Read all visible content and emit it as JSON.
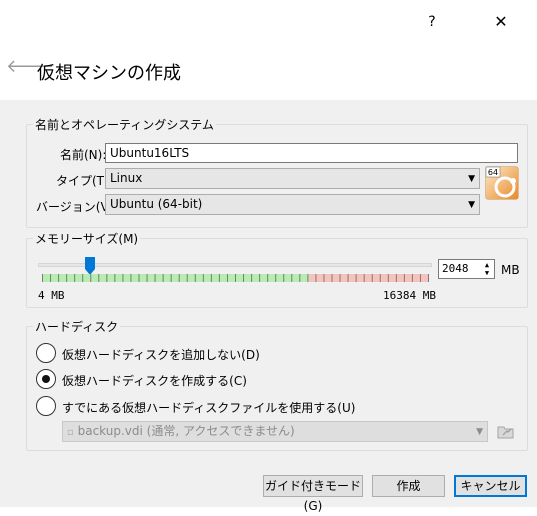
{
  "titlebar": {
    "help_label": "?",
    "close_label": "✕"
  },
  "header": {
    "back_icon": "back-arrow-icon",
    "title": "仮想マシンの作成"
  },
  "name_os": {
    "legend": "名前とオペレーティングシステム",
    "name_label": "名前(N):",
    "name_value": "Ubuntu16LTS",
    "type_label": "タイプ(T):",
    "type_value": "Linux",
    "version_label": "バージョン(V):",
    "version_value": "Ubuntu (64-bit)",
    "os_icon_badge": "64"
  },
  "memory": {
    "legend": "メモリーサイズ(M)",
    "value": "2048",
    "unit": "MB",
    "min_label": "4 MB",
    "max_label": "16384 MB",
    "slider_min": 4,
    "slider_max": 16384,
    "slider_value": 2048
  },
  "harddisk": {
    "legend": "ハードディスク",
    "options": [
      {
        "label": "仮想ハードディスクを追加しない(D)",
        "checked": false
      },
      {
        "label": "仮想ハードディスクを作成する(C)",
        "checked": true
      },
      {
        "label": "すでにある仮想ハードディスクファイルを使用する(U)",
        "checked": false
      }
    ],
    "existing_file": "backup.vdi (通常, アクセスできません)"
  },
  "footer": {
    "guided_mode_label": "ガイド付きモード(G)",
    "create_label": "作成",
    "cancel_label": "キャンセル"
  },
  "colors": {
    "accent": "#0078d7",
    "slider_green": "#b8ecb2",
    "slider_red": "#f5c3bd"
  }
}
